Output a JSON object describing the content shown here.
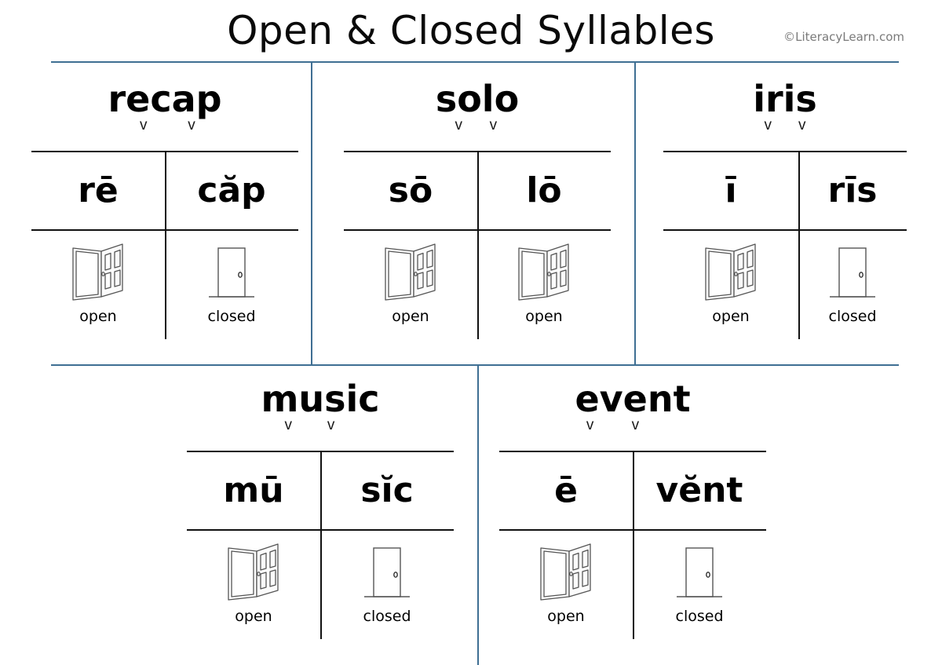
{
  "header": {
    "title": "Open & Closed Syllables",
    "copyright": "©LiteracyLearn.com"
  },
  "labels": {
    "open": "open",
    "closed": "closed",
    "vowel_mark": "v"
  },
  "colors": {
    "frame_rule": "#3f6f93",
    "table_rule": "#111111",
    "text": "#000000",
    "copyright_text": "#7a7a7a",
    "door_line": "#555555"
  },
  "cards": [
    {
      "word": "recap",
      "vowel_marks": 2,
      "syllables": [
        {
          "text": "rē",
          "mark": "macron",
          "door": "open"
        },
        {
          "text": "căp",
          "mark": "breve",
          "door": "closed"
        }
      ]
    },
    {
      "word": "solo",
      "vowel_marks": 2,
      "syllables": [
        {
          "text": "sō",
          "mark": "macron",
          "door": "open"
        },
        {
          "text": "lō",
          "mark": "macron",
          "door": "open"
        }
      ]
    },
    {
      "word": "iris",
      "vowel_marks": 2,
      "syllables": [
        {
          "text": "ī",
          "mark": "macron",
          "door": "open"
        },
        {
          "text": "rīs",
          "mark": "breve",
          "door": "closed"
        }
      ]
    },
    {
      "word": "music",
      "vowel_marks": 2,
      "syllables": [
        {
          "text": "mū",
          "mark": "macron",
          "door": "open"
        },
        {
          "text": "sĭc",
          "mark": "breve",
          "door": "closed"
        }
      ]
    },
    {
      "word": "event",
      "vowel_marks": 2,
      "syllables": [
        {
          "text": "ē",
          "mark": "macron",
          "door": "open"
        },
        {
          "text": "vĕnt",
          "mark": "breve",
          "door": "closed"
        }
      ]
    }
  ]
}
